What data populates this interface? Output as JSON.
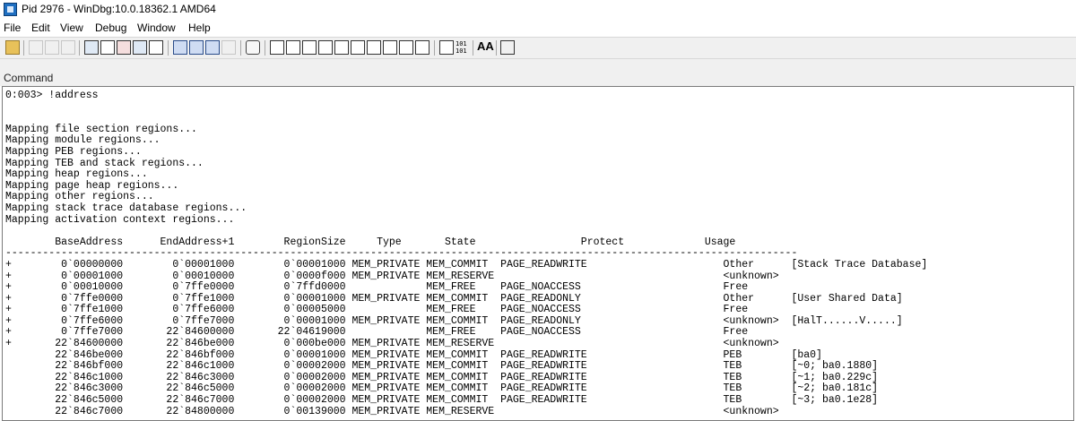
{
  "window": {
    "title": "Pid 2976 - WinDbg:10.0.18362.1 AMD64"
  },
  "menu": [
    "File",
    "Edit",
    "View",
    "Debug",
    "Window",
    "Help"
  ],
  "toolbar": {
    "glyph_101": "101",
    "glyph_101b": "101",
    "aa": "AA"
  },
  "pane": {
    "title": "Command"
  },
  "output": {
    "lines": [
      "0:003> !address",
      "",
      "",
      "Mapping file section regions...",
      "Mapping module regions...",
      "Mapping PEB regions...",
      "Mapping TEB and stack regions...",
      "Mapping heap regions...",
      "Mapping page heap regions...",
      "Mapping other regions...",
      "Mapping stack trace database regions...",
      "Mapping activation context regions...",
      "",
      "        BaseAddress      EndAddress+1        RegionSize     Type       State                 Protect             Usage",
      "--------------------------------------------------------------------------------------------------------------------------------",
      "+        0`00000000        0`00001000        0`00001000 MEM_PRIVATE MEM_COMMIT  PAGE_READWRITE                      Other      [Stack Trace Database]",
      "+        0`00001000        0`00010000        0`0000f000 MEM_PRIVATE MEM_RESERVE                                     <unknown>",
      "+        0`00010000        0`7ffe0000        0`7ffd0000             MEM_FREE    PAGE_NOACCESS                       Free",
      "+        0`7ffe0000        0`7ffe1000        0`00001000 MEM_PRIVATE MEM_COMMIT  PAGE_READONLY                       Other      [User Shared Data]",
      "+        0`7ffe1000        0`7ffe6000        0`00005000             MEM_FREE    PAGE_NOACCESS                       Free",
      "+        0`7ffe6000        0`7ffe7000        0`00001000 MEM_PRIVATE MEM_COMMIT  PAGE_READONLY                       <unknown>  [HalT......V.....]",
      "+        0`7ffe7000       22`84600000       22`04619000             MEM_FREE    PAGE_NOACCESS                       Free",
      "+       22`84600000       22`846be000        0`000be000 MEM_PRIVATE MEM_RESERVE                                     <unknown>",
      "        22`846be000       22`846bf000        0`00001000 MEM_PRIVATE MEM_COMMIT  PAGE_READWRITE                      PEB        [ba0]",
      "        22`846bf000       22`846c1000        0`00002000 MEM_PRIVATE MEM_COMMIT  PAGE_READWRITE                      TEB        [~0; ba0.1880]",
      "        22`846c1000       22`846c3000        0`00002000 MEM_PRIVATE MEM_COMMIT  PAGE_READWRITE                      TEB        [~1; ba0.229c]",
      "        22`846c3000       22`846c5000        0`00002000 MEM_PRIVATE MEM_COMMIT  PAGE_READWRITE                      TEB        [~2; ba0.181c]",
      "        22`846c5000       22`846c7000        0`00002000 MEM_PRIVATE MEM_COMMIT  PAGE_READWRITE                      TEB        [~3; ba0.1e28]",
      "        22`846c7000       22`84800000        0`00139000 MEM_PRIVATE MEM_RESERVE                                     <unknown>"
    ]
  }
}
